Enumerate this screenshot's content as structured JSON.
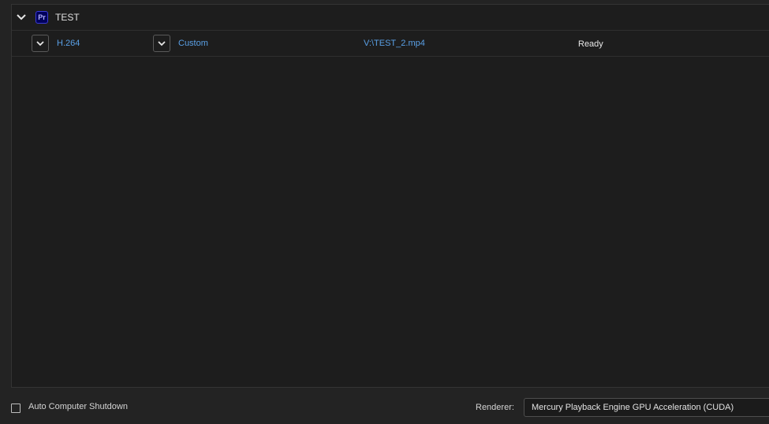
{
  "queue": {
    "group": {
      "name": "TEST",
      "app_icon_label": "Pr"
    },
    "items": [
      {
        "format": "H.264",
        "preset": "Custom",
        "output_file": "V:\\TEST_2.mp4",
        "status": "Ready"
      }
    ]
  },
  "footer": {
    "auto_shutdown_label": "Auto Computer Shutdown",
    "auto_shutdown_checked": false,
    "renderer_label": "Renderer:",
    "renderer_value": "Mercury Playback Engine GPU Acceleration (CUDA)"
  },
  "colors": {
    "link": "#5aa0e6",
    "app_icon_bg": "#00005b",
    "panel_bg": "#1d1d1d"
  }
}
